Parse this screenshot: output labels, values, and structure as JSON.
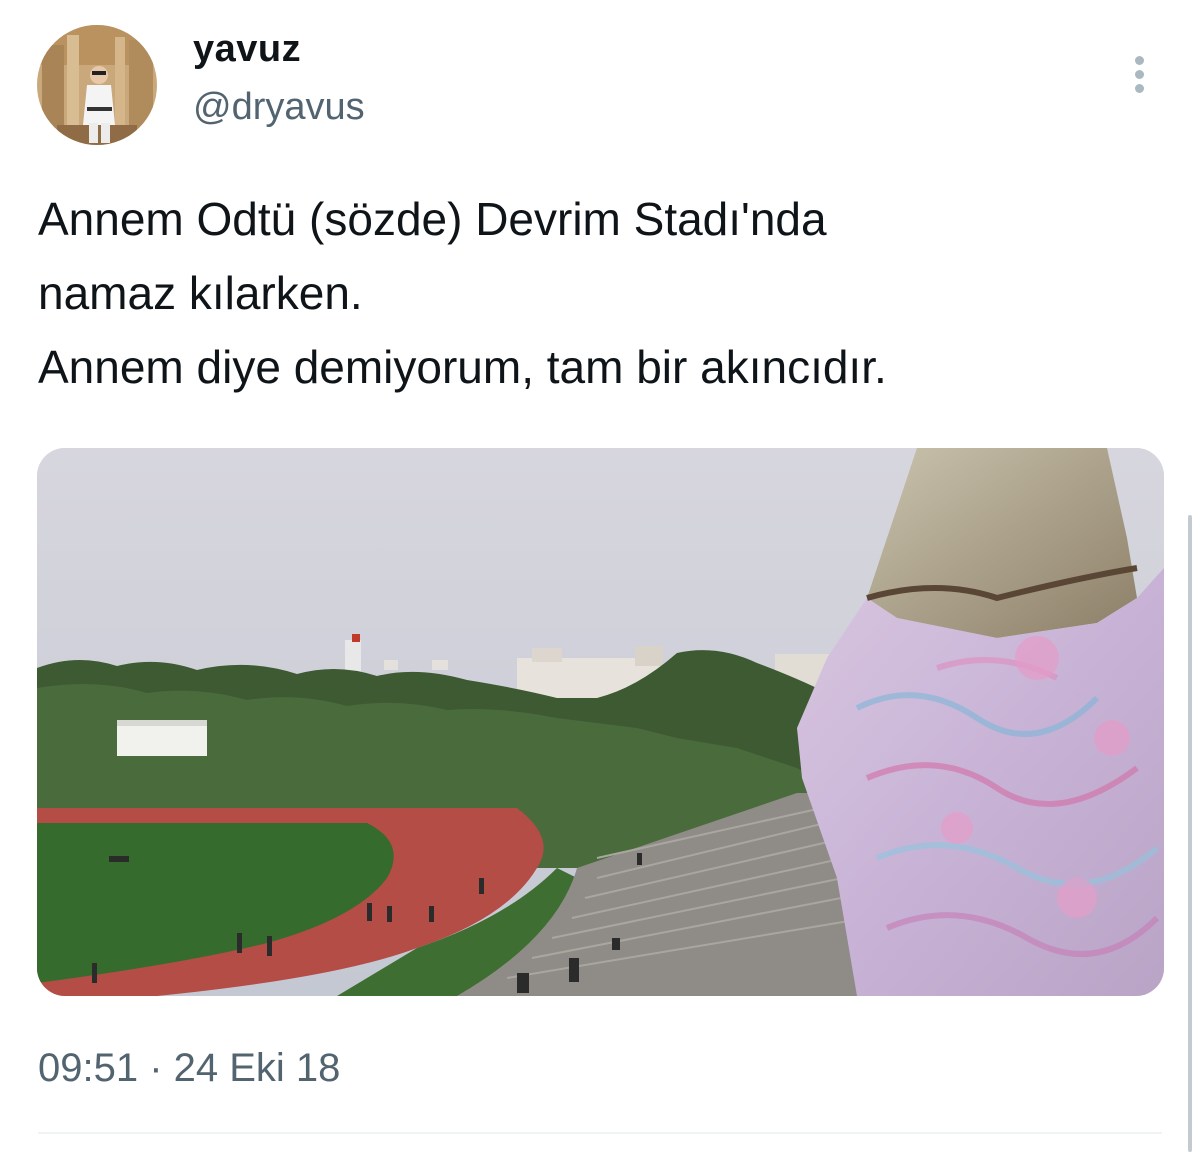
{
  "tweet": {
    "author": {
      "display_name": "yavuz",
      "handle": "@dryavus"
    },
    "text": "Annem Odtü (sözde) Devrim Stadı'nda\nnamaz kılarken.\nAnnem diye demiyorum, tam bir akıncıdır.",
    "timestamp": "09:51 · 24 Eki 18",
    "media": {
      "description_icon": "photo"
    }
  },
  "colors": {
    "text_primary": "#0f1419",
    "text_secondary": "#536471",
    "divider": "#eff3f4",
    "more_dots": "#aab8c2"
  }
}
